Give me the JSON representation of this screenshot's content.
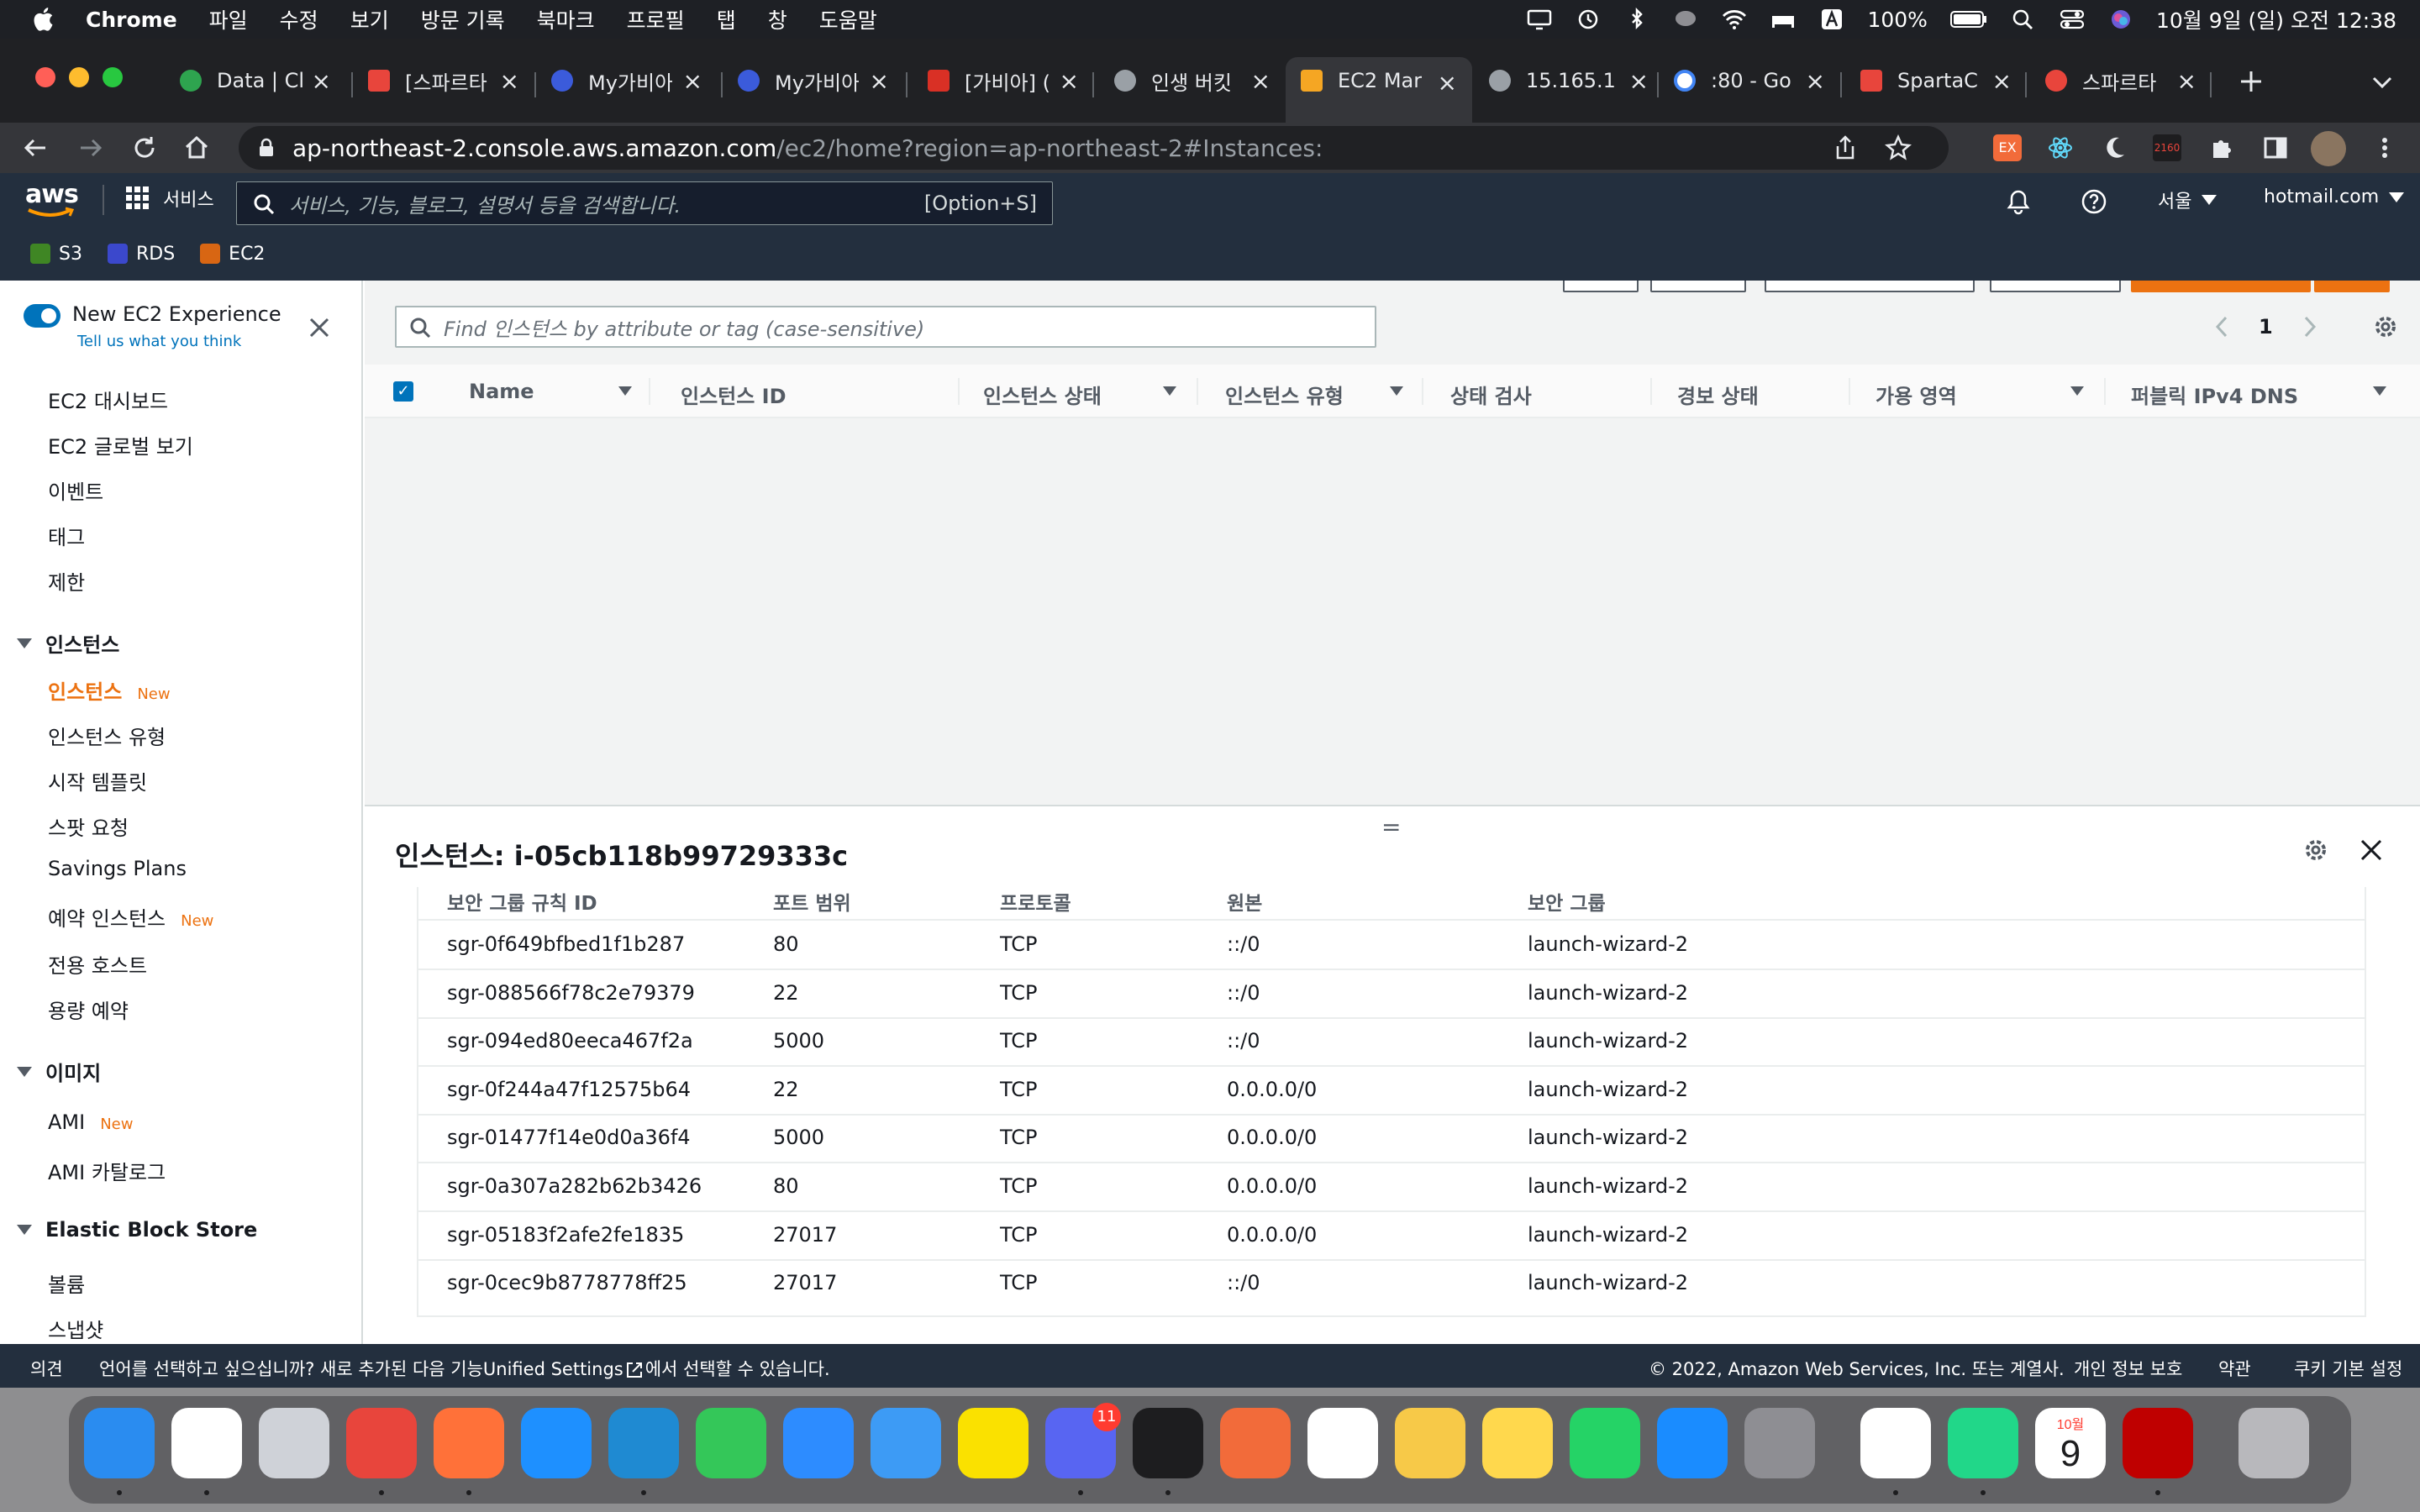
{
  "menubar": {
    "app": "Chrome",
    "items": [
      "파일",
      "수정",
      "보기",
      "방문 기록",
      "북마크",
      "프로필",
      "탭",
      "창",
      "도움말"
    ],
    "battery": "100%",
    "datetime": "10월 9일 (일) 오전  12:38"
  },
  "tabs": [
    {
      "title": "Data | Cl",
      "color": "#2ea44f"
    },
    {
      "title": "[스파르타",
      "color": "#e8453c"
    },
    {
      "title": "My가비아",
      "color": "#3b5bdb"
    },
    {
      "title": "My가비아",
      "color": "#3b5bdb"
    },
    {
      "title": "[가비아] (",
      "color": "#d93025"
    },
    {
      "title": "인생 버킷",
      "color": "#9aa0a6"
    },
    {
      "title": "EC2 Mar",
      "color": "#f5a623"
    },
    {
      "title": "15.165.1",
      "color": "#9aa0a6"
    },
    {
      "title": ":80 - Go",
      "color": "#ffffff"
    },
    {
      "title": "SpartaC",
      "color": "#e8453c"
    },
    {
      "title": "스파르타",
      "color": "#e8453c"
    }
  ],
  "address": {
    "host": "ap-northeast-2.console.aws.amazon.com",
    "path": "/ec2/home?region=ap-northeast-2#Instances:"
  },
  "aws_header": {
    "logo": "aws",
    "services": "서비스",
    "search_placeholder": "서비스, 기능, 블로그, 설명서 등을 검색합니다.",
    "search_shortcut": "[Option+S]",
    "region": "서울",
    "account": "hotmail.com"
  },
  "favorites": [
    "S3",
    "RDS",
    "EC2"
  ],
  "sidebar": {
    "experience_title": "New EC2 Experience",
    "experience_link": "Tell us what you think",
    "top_links": [
      "EC2 대시보드",
      "EC2 글로벌 보기",
      "이벤트",
      "태그",
      "제한"
    ],
    "section_instances": "인스턴스",
    "instances_items": [
      "인스턴스",
      "인스턴스 유형",
      "시작 템플릿",
      "스팟 요청",
      "Savings Plans",
      "예약 인스턴스",
      "전용 호스트",
      "용량 예약"
    ],
    "section_images": "이미지",
    "images_items": [
      "AMI",
      "AMI 카탈로그"
    ],
    "section_ebs": "Elastic Block Store",
    "ebs_items": [
      "볼륨",
      "스냅샷"
    ],
    "new_badge": "New"
  },
  "instances_table": {
    "search_placeholder": "Find 인스턴스 by attribute or tag (case-sensitive)",
    "page": "1",
    "columns": [
      "Name",
      "인스턴스 ID",
      "인스턴스 상태",
      "인스턴스 유형",
      "상태 검사",
      "경보 상태",
      "가용 영역",
      "퍼블릭 IPv4 DNS"
    ]
  },
  "details": {
    "title": "인스턴스: i-05cb118b99729333c",
    "columns": [
      "보안 그룹 규칙 ID",
      "포트 범위",
      "프로토콜",
      "원본",
      "보안 그룹"
    ],
    "rows": [
      [
        "sgr-0f649bfbed1f1b287",
        "80",
        "TCP",
        "::/0",
        "launch-wizard-2"
      ],
      [
        "sgr-088566f78c2e79379",
        "22",
        "TCP",
        "::/0",
        "launch-wizard-2"
      ],
      [
        "sgr-094ed80eeca467f2a",
        "5000",
        "TCP",
        "::/0",
        "launch-wizard-2"
      ],
      [
        "sgr-0f244a47f12575b64",
        "22",
        "TCP",
        "0.0.0.0/0",
        "launch-wizard-2"
      ],
      [
        "sgr-01477f14e0d0a36f4",
        "5000",
        "TCP",
        "0.0.0.0/0",
        "launch-wizard-2"
      ],
      [
        "sgr-0a307a282b62b3426",
        "80",
        "TCP",
        "0.0.0.0/0",
        "launch-wizard-2"
      ],
      [
        "sgr-05183f2afe2fe1835",
        "27017",
        "TCP",
        "0.0.0.0/0",
        "launch-wizard-2"
      ],
      [
        "sgr-0cec9b8778778ff25",
        "27017",
        "TCP",
        "::/0",
        "launch-wizard-2"
      ]
    ]
  },
  "footer": {
    "feedback": "의견",
    "lang_prefix": "언어를 선택하고 싶으십니까? 새로 추가된 다음 기능",
    "lang_link": "Unified Settings",
    "lang_suffix": "에서 선택할 수 있습니다.",
    "copyright": "© 2022, Amazon Web Services, Inc. 또는 계열사.",
    "privacy": "개인 정보 보호",
    "terms": "약관",
    "cookies": "쿠키 기본 설정"
  },
  "dock": {
    "discord_badge": "11",
    "calendar_month": "10월",
    "calendar_day": "9",
    "apps": [
      {
        "name": "finder",
        "color": "#2a8cf0"
      },
      {
        "name": "notion",
        "color": "#ffffff"
      },
      {
        "name": "launchpad",
        "color": "#cfd2d8"
      },
      {
        "name": "chrome",
        "color": "#e8453c"
      },
      {
        "name": "firefox",
        "color": "#ff7139"
      },
      {
        "name": "safari",
        "color": "#1e90ff"
      },
      {
        "name": "vscode",
        "color": "#1f8ad2"
      },
      {
        "name": "messages",
        "color": "#34c759"
      },
      {
        "name": "zoom",
        "color": "#2d8cff"
      },
      {
        "name": "mail",
        "color": "#3d9bf5"
      },
      {
        "name": "kakaotalk",
        "color": "#fae100"
      },
      {
        "name": "discord",
        "color": "#5865f2"
      },
      {
        "name": "terminal",
        "color": "#1d1d1f"
      },
      {
        "name": "pencil",
        "color": "#f26b3a"
      },
      {
        "name": "nvidia",
        "color": "#ffffff"
      },
      {
        "name": "photos",
        "color": "#f7c948"
      },
      {
        "name": "notes",
        "color": "#ffd84d"
      },
      {
        "name": "whatsapp",
        "color": "#25d366"
      },
      {
        "name": "appstore",
        "color": "#1a8cff"
      },
      {
        "name": "settings",
        "color": "#8e8e93"
      },
      {
        "name": "slack",
        "color": "#ffffff"
      },
      {
        "name": "pycharm",
        "color": "#21d789"
      },
      {
        "name": "calendar",
        "color": "#ffffff"
      },
      {
        "name": "filezilla",
        "color": "#bf0000"
      },
      {
        "name": "trash",
        "color": "#b8b8bc"
      }
    ]
  }
}
